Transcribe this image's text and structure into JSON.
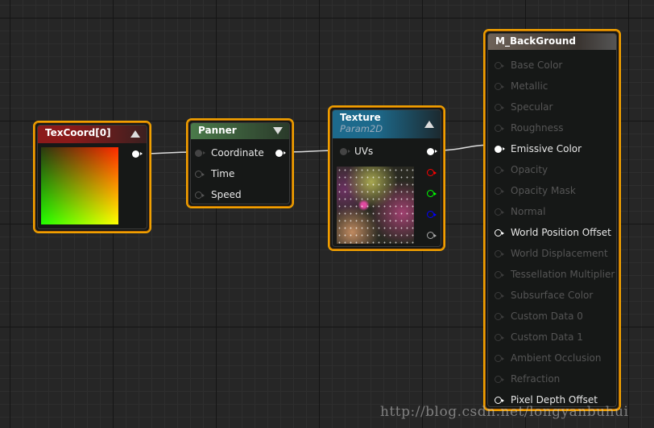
{
  "nodes": {
    "texcoord": {
      "title": "TexCoord[0]",
      "header_color": "#8b1a1a"
    },
    "panner": {
      "title": "Panner",
      "inputs": [
        "Coordinate",
        "Time",
        "Speed"
      ],
      "header_color": "#3f6a3f"
    },
    "texture": {
      "title": "Texture",
      "subtitle": "Param2D",
      "input": "UVs",
      "header_color": "#1d6a8c",
      "output_pin_colors": [
        "#ffffff",
        "#ff0000",
        "#00ff00",
        "#0000ff",
        "#aaaaaa"
      ]
    },
    "material": {
      "title": "M_BackGround",
      "header_color": "#6e6258",
      "inputs": [
        {
          "label": "Base Color",
          "enabled": false
        },
        {
          "label": "Metallic",
          "enabled": false
        },
        {
          "label": "Specular",
          "enabled": false
        },
        {
          "label": "Roughness",
          "enabled": false
        },
        {
          "label": "Emissive Color",
          "enabled": true,
          "connected": true
        },
        {
          "label": "Opacity",
          "enabled": false
        },
        {
          "label": "Opacity Mask",
          "enabled": false
        },
        {
          "label": "Normal",
          "enabled": false
        },
        {
          "label": "World Position Offset",
          "enabled": true
        },
        {
          "label": "World Displacement",
          "enabled": false
        },
        {
          "label": "Tessellation Multiplier",
          "enabled": false
        },
        {
          "label": "Subsurface Color",
          "enabled": false
        },
        {
          "label": "Custom Data 0",
          "enabled": false
        },
        {
          "label": "Custom Data 1",
          "enabled": false
        },
        {
          "label": "Ambient Occlusion",
          "enabled": false
        },
        {
          "label": "Refraction",
          "enabled": false
        },
        {
          "label": "Pixel Depth Offset",
          "enabled": true
        }
      ]
    }
  },
  "selection_color": "#f0a000",
  "watermark": "http://blog.csdn.net/longyanbuhui"
}
